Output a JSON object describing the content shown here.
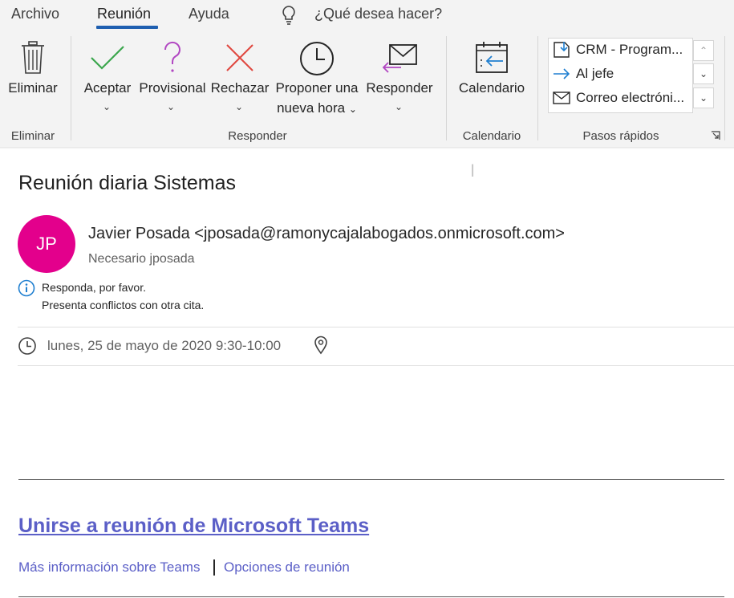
{
  "menu": {
    "tabs": [
      {
        "label": "Archivo"
      },
      {
        "label": "Reunión"
      },
      {
        "label": "Ayuda"
      }
    ],
    "search_placeholder": "¿Qué desea hacer?"
  },
  "ribbon": {
    "delete_label": "Eliminar",
    "accept_label": "Aceptar",
    "tentative_label": "Provisional",
    "decline_label": "Rechazar",
    "propose_line1": "Proponer una",
    "propose_line2": "nueva hora",
    "reply_label": "Responder",
    "calendar_label": "Calendario",
    "groups": {
      "delete": "Eliminar",
      "respond": "Responder",
      "calendar": "Calendario",
      "quick_steps": "Pasos rápidos"
    },
    "quick_steps": [
      {
        "label": "CRM - Program...",
        "icon": "file-arrow-icon"
      },
      {
        "label": "Al jefe",
        "icon": "arrow-right-icon"
      },
      {
        "label": "Correo electróni...",
        "icon": "envelope-icon"
      }
    ]
  },
  "meeting": {
    "subject": "Reunión diaria Sistemas",
    "avatar_initials": "JP",
    "sender": "Javier  Posada <jposada@ramonycajalabogados.onmicrosoft.com>",
    "required": "Necesario   jposada",
    "info_line1": "Responda, por favor.",
    "info_line2": "Presenta conflictos con otra cita.",
    "when": "lunes, 25 de mayo de 2020 9:30-10:00",
    "teams_link": "Unirse a reunión de Microsoft Teams",
    "more_info": "Más información sobre Teams",
    "options": "Opciones de reunión"
  },
  "colors": {
    "accent": "#1f5fb0",
    "avatar_bg": "#e3008c",
    "link": "#5b5fc7",
    "accept": "#3aa64c",
    "tentative": "#b146c2",
    "decline": "#e0473f"
  }
}
